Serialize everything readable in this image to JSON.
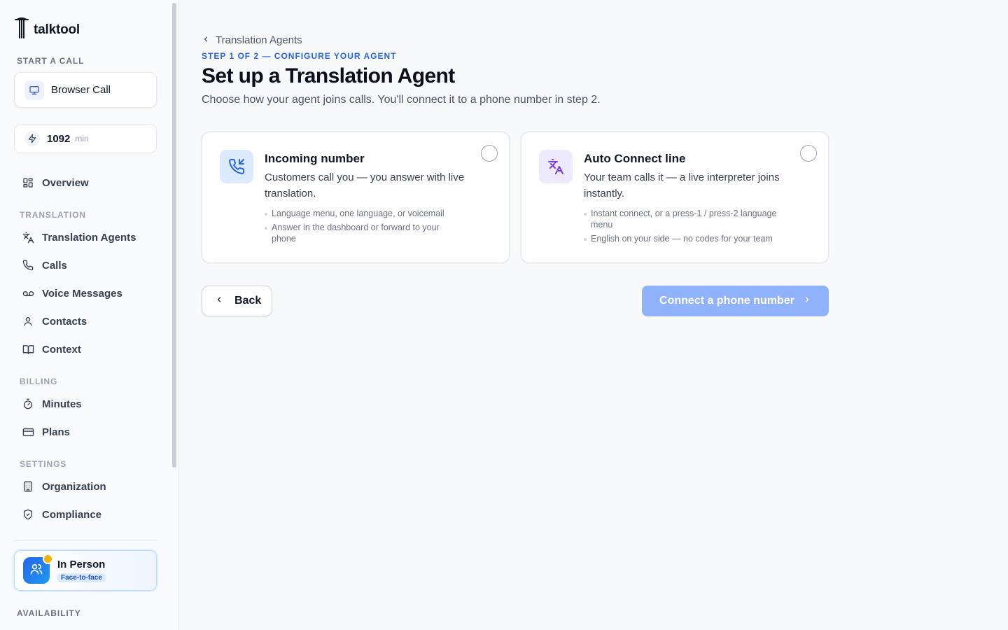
{
  "app": {
    "name": "talktool"
  },
  "sidebar": {
    "start_call_heading": "START A CALL",
    "browser_call_label": "Browser Call",
    "minutes_value": "1092",
    "minutes_unit": "min",
    "overview_label": "Overview",
    "sections": {
      "translation": "TRANSLATION",
      "billing": "BILLING",
      "settings": "SETTINGS",
      "availability": "AVAILABILITY"
    },
    "items": {
      "translation_agents": "Translation Agents",
      "calls": "Calls",
      "voice_messages": "Voice Messages",
      "contacts": "Contacts",
      "context": "Context",
      "minutes": "Minutes",
      "plans": "Plans",
      "organization": "Organization",
      "compliance": "Compliance"
    },
    "in_person": {
      "title": "In Person",
      "badge": "Face-to-face"
    }
  },
  "main": {
    "breadcrumb": "Translation Agents",
    "step": "STEP 1 OF 2 — CONFIGURE YOUR AGENT",
    "title": "Set up a Translation Agent",
    "subtitle": "Choose how your agent joins calls. You'll connect it to a phone number in step 2.",
    "options": [
      {
        "icon": "phone-incoming-icon",
        "title": "Incoming number",
        "description": "Customers call you — you answer with live translation.",
        "bullets": [
          "Language menu, one language, or voicemail",
          "Answer in the dashboard or forward to your phone"
        ],
        "selected": false
      },
      {
        "icon": "translate-icon",
        "title": "Auto Connect line",
        "description": "Your team calls it — a live interpreter joins instantly.",
        "bullets": [
          "Instant connect, or a press-1 / press-2 language menu",
          "English on your side — no codes for your team"
        ],
        "selected": false
      }
    ],
    "back_label": "Back",
    "next_label": "Connect a phone number"
  },
  "colors": {
    "accent": "#2563eb",
    "next_button_disabled": "#8fb2fb",
    "translate_icon": "#7c3aed"
  }
}
